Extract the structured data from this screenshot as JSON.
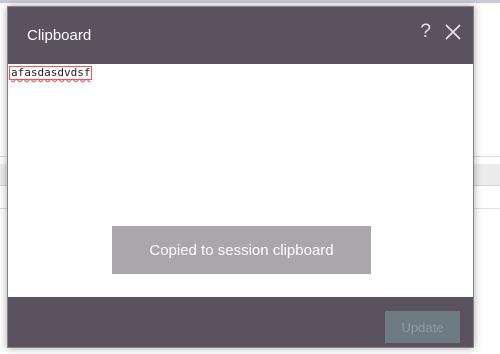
{
  "dialog": {
    "title": "Clipboard",
    "help_icon": "question-mark-icon",
    "help_glyph": "?",
    "close_icon": "close-x-icon"
  },
  "clipboard": {
    "content": "afasdasdvdsf"
  },
  "toast": {
    "message": "Copied to session clipboard"
  },
  "footer": {
    "update_label": "Update",
    "update_enabled": false
  },
  "colors": {
    "header_bg": "#5b5260",
    "toast_bg": "#aaa6ab",
    "update_bg": "#6f7b84"
  }
}
